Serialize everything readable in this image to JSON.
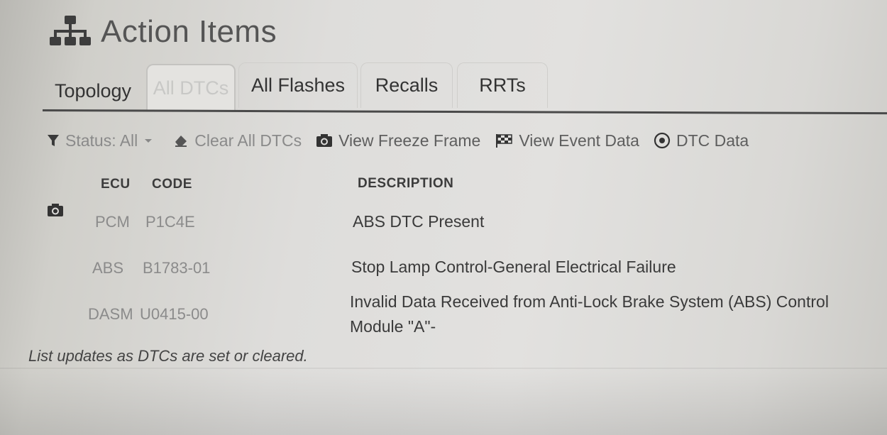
{
  "header": {
    "title": "Action Items",
    "icon": "network-topology-icon"
  },
  "tabs": [
    {
      "label": "Topology",
      "active": false
    },
    {
      "label": "All DTCs",
      "active": true
    },
    {
      "label": "All Flashes",
      "active": false
    },
    {
      "label": "Recalls",
      "active": false
    },
    {
      "label": "RRTs",
      "active": false
    }
  ],
  "toolbar": {
    "status_filter": "Status: All",
    "clear_all": "Clear All DTCs",
    "view_freeze_frame": "View Freeze Frame",
    "view_event_data": "View Event Data",
    "dtc_data": "DTC Data"
  },
  "table": {
    "columns": {
      "ecu": "ECU",
      "code": "CODE",
      "description": "DESCRIPTION"
    },
    "rows": [
      {
        "ecu": "PCM",
        "code": "P1C4E",
        "description": "ABS DTC Present",
        "has_freeze_frame": true
      },
      {
        "ecu": "ABS",
        "code": "B1783-01",
        "description": "Stop Lamp Control-General Electrical Failure",
        "has_freeze_frame": false
      },
      {
        "ecu": "DASM",
        "code": "U0415-00",
        "description_line1": "Invalid Data Received from Anti-Lock Brake System (ABS) Control",
        "description_line2": "Module \"A\"-",
        "has_freeze_frame": false
      }
    ]
  },
  "footer": {
    "note": "List updates as DTCs are set or cleared."
  },
  "colors": {
    "active_tab_text": "#c8c8c6",
    "divider": "#4a4a4a",
    "faded_cell_text": "#8b8b8b"
  }
}
